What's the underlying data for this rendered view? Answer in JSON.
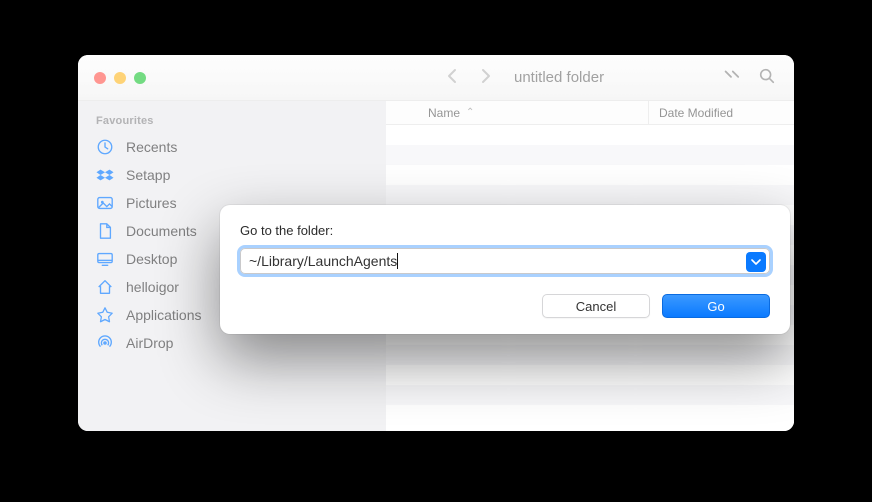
{
  "window": {
    "title": "untitled folder"
  },
  "sidebar": {
    "header": "Favourites",
    "items": [
      {
        "label": "Recents",
        "icon": "clock-icon"
      },
      {
        "label": "Setapp",
        "icon": "dropbox-icon"
      },
      {
        "label": "Pictures",
        "icon": "pictures-icon"
      },
      {
        "label": "Documents",
        "icon": "document-icon"
      },
      {
        "label": "Desktop",
        "icon": "desktop-icon"
      },
      {
        "label": "helloigor",
        "icon": "home-icon"
      },
      {
        "label": "Applications",
        "icon": "applications-icon"
      },
      {
        "label": "AirDrop",
        "icon": "airdrop-icon"
      }
    ]
  },
  "columns": {
    "name": "Name",
    "date": "Date Modified"
  },
  "dialog": {
    "label": "Go to the folder:",
    "path": "~/Library/LaunchAgents",
    "cancel": "Cancel",
    "go": "Go"
  }
}
